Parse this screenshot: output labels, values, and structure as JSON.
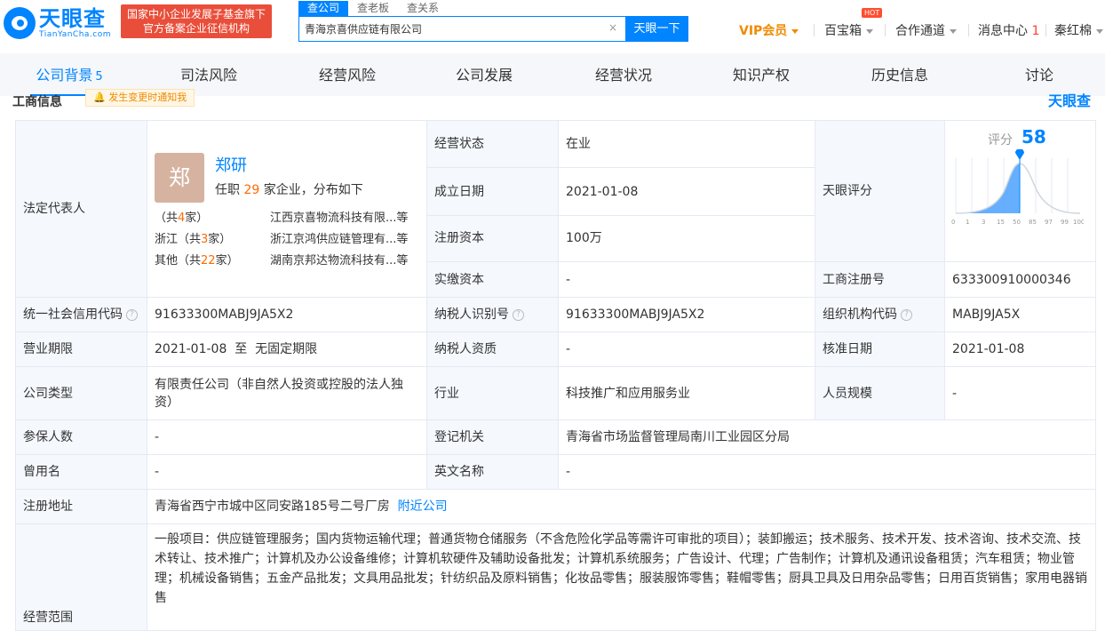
{
  "header": {
    "logo_cn": "天眼查",
    "logo_en": "TianYanCha.com",
    "badge_line1": "国家中小企业发展子基金旗下",
    "badge_line2": "官方备案企业征信机构",
    "search_tabs": [
      "查公司",
      "查老板",
      "查关系"
    ],
    "search_value": "青海京喜供应链有限公司",
    "search_clear": "×",
    "search_button": "天眼一下",
    "vip": "VIP会员",
    "baibao": "百宝箱",
    "hot": "HOT",
    "coop": "合作通道",
    "msg_label": "消息中心",
    "msg_count": "1",
    "user": "秦红棉"
  },
  "nav": {
    "items": [
      {
        "label": "公司背景",
        "count": "5"
      },
      {
        "label": "司法风险"
      },
      {
        "label": "经营风险"
      },
      {
        "label": "公司发展"
      },
      {
        "label": "经营状况"
      },
      {
        "label": "知识产权"
      },
      {
        "label": "历史信息"
      },
      {
        "label": "讨论"
      }
    ]
  },
  "section": {
    "title": "工商信息",
    "notice": "发生变更时通知我",
    "brand": "天眼查"
  },
  "info": {
    "legal_label": "法定代表人",
    "legal_avatar": "郑",
    "legal_name": "郑研",
    "legal_sub_pre": "任职",
    "legal_sub_num": "29",
    "legal_sub_post": "家企业，分布如下",
    "dist": [
      {
        "region_pre": "（共",
        "region_num": "4",
        "region_post": "家）",
        "company": "江西京喜物流科技有限...等"
      },
      {
        "region_pre": "浙江（共",
        "region_num": "3",
        "region_post": "家）",
        "company": "浙江京鸿供应链管理有...等"
      },
      {
        "region_pre": "其他（共",
        "region_num": "22",
        "region_post": "家）",
        "company": "湖南京邦达物流科技有...等"
      }
    ],
    "status_label": "经营状态",
    "status": "在业",
    "found_label": "成立日期",
    "found": "2021-01-08",
    "capital_label": "注册资本",
    "capital": "100万",
    "paid_label": "实缴资本",
    "paid": "-",
    "score_label_cell": "天眼评分",
    "score_label": "评分",
    "score": "58",
    "score_ticks": [
      "0",
      "1",
      "3",
      "15",
      "50",
      "85",
      "97",
      "99",
      "100"
    ],
    "reg_no_label": "工商注册号",
    "reg_no": "633300910000346",
    "credit_label": "统一社会信用代码",
    "credit": "91633300MABJ9JA5X2",
    "tax_label": "纳税人识别号",
    "tax": "91633300MABJ9JA5X2",
    "org_label": "组织机构代码",
    "org": "MABJ9JA5X",
    "term_label": "营业期限",
    "term": "2021-01-08  至  无固定期限",
    "taxq_label": "纳税人资质",
    "taxq": "-",
    "approve_label": "核准日期",
    "approve": "2021-01-08",
    "type_label": "公司类型",
    "type": "有限责任公司（非自然人投资或控股的法人独资）",
    "industry_label": "行业",
    "industry": "科技推广和应用服务业",
    "staff_label": "人员规模",
    "staff": "-",
    "insured_label": "参保人数",
    "insured": "-",
    "authority_label": "登记机关",
    "authority": "青海省市场监督管理局南川工业园区分局",
    "former_label": "曾用名",
    "former": "-",
    "en_label": "英文名称",
    "en": "-",
    "address_label": "注册地址",
    "address": "青海省西宁市城中区同安路185号二号厂房",
    "nearby": "附近公司",
    "scope_label": "经营范围",
    "scope": "一般项目：供应链管理服务；国内货物运输代理；普通货物仓储服务（不含危险化学品等需许可审批的项目）；装卸搬运；技术服务、技术开发、技术咨询、技术交流、技术转让、技术推广；计算机及办公设备维修；计算机软硬件及辅助设备批发；计算机系统服务；广告设计、代理；广告制作；计算机及通讯设备租赁；汽车租赁；物业管理；机械设备销售；五金产品批发；文具用品批发；针纺织品及原料销售；化妆品零售；服装服饰零售；鞋帽零售；厨具卫具及日用杂品零售；日用百货销售；家用电器销售"
  },
  "colors": {
    "accent": "#0084ff",
    "orange": "#f08a00",
    "badge": "#e94e3a"
  }
}
